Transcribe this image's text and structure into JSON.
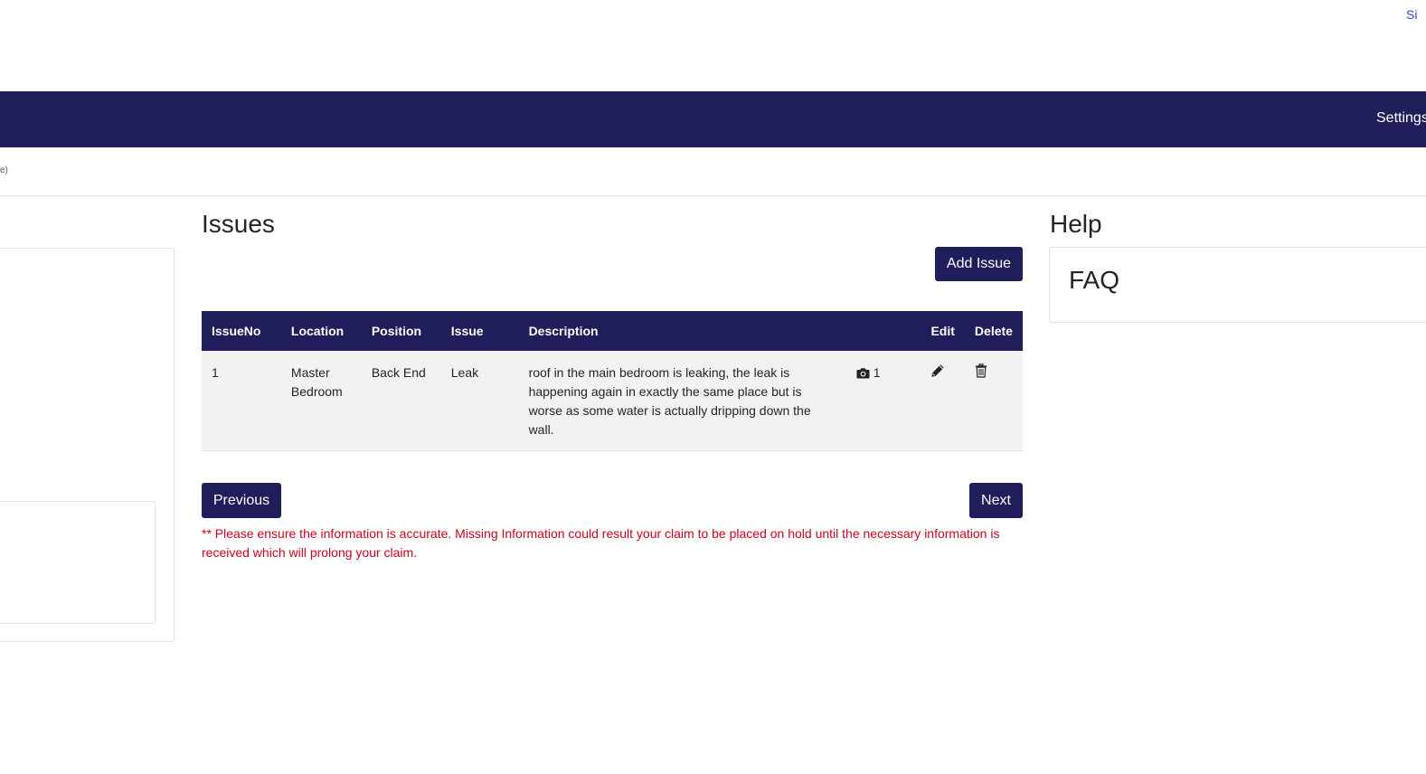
{
  "header": {
    "top_link": "Si",
    "nav_settings": "Settings",
    "subheader_fragment": "e)"
  },
  "issues": {
    "title": "Issues",
    "add_button": "Add Issue",
    "columns": [
      "IssueNo",
      "Location",
      "Position",
      "Issue",
      "Description",
      "",
      "Edit",
      "Delete"
    ],
    "rows": [
      {
        "no": "1",
        "location": "Master Bedroom",
        "position": "Back End",
        "issue": "Leak",
        "description": "roof in the main bedroom is leaking, the leak is happening again in exactly the same place but is worse as some water is actually dripping down the wall.",
        "photo_icon": "camera-icon",
        "photo_count": "1",
        "edit_icon": "pencil-icon",
        "delete_icon": "trash-icon"
      }
    ],
    "previous_button": "Previous",
    "next_button": "Next",
    "notice": "** Please ensure the information is accurate. Missing Information could result your claim to be placed on hold until the necessary information is received which will prolong your claim."
  },
  "help": {
    "title": "Help",
    "faq_title": "FAQ"
  },
  "colors": {
    "navy": "#1f1d5a",
    "notice_red": "#d0021b",
    "link_blue": "#3a4bbf"
  }
}
